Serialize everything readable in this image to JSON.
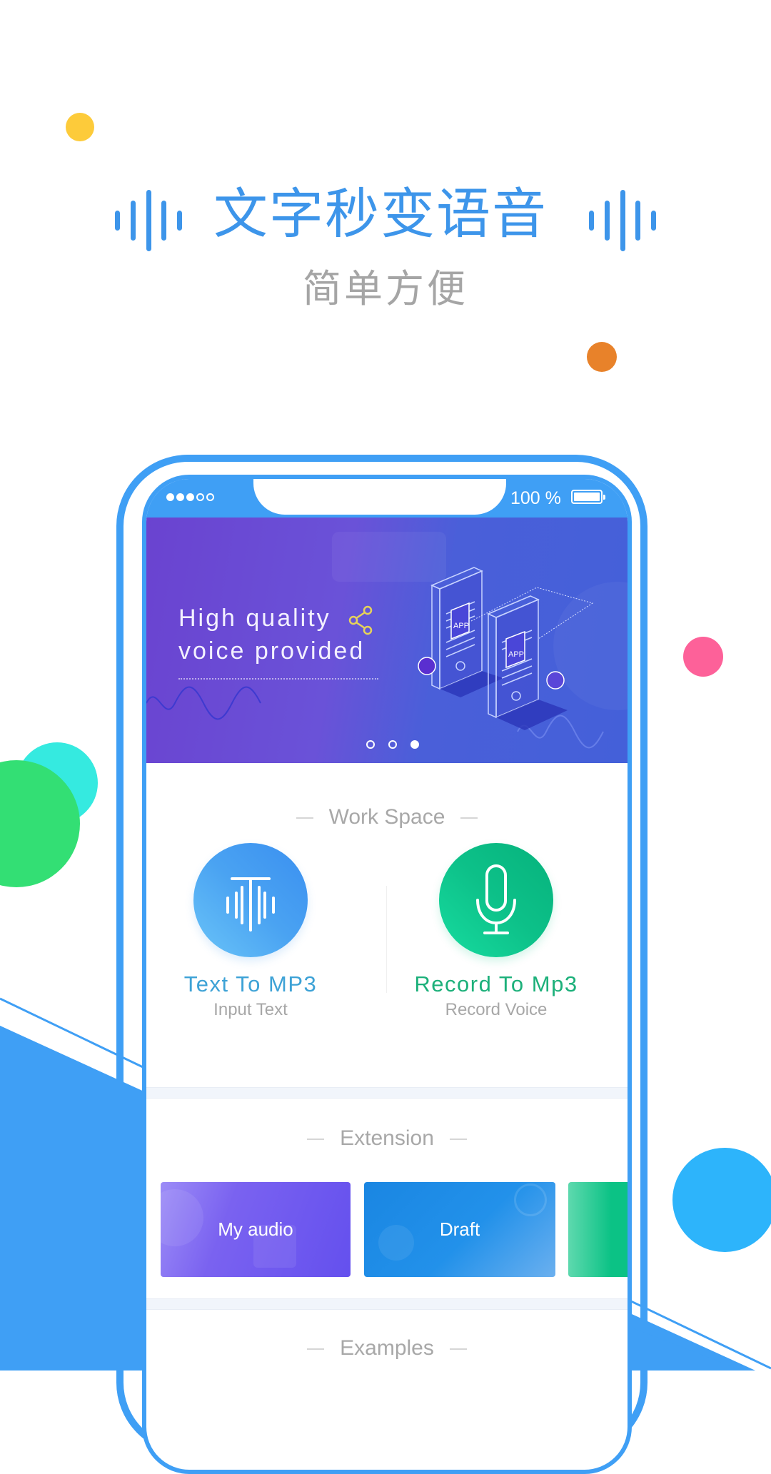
{
  "hero": {
    "title": "文字秒变语音",
    "subtitle": "简单方便"
  },
  "colors": {
    "accent_blue": "#3d95ea",
    "frame_blue": "#3f9ff5",
    "record_green": "#1ec08a",
    "dot_yellow": "#fdcb3a",
    "dot_orange": "#e8822a",
    "dot_pink": "#fd6199",
    "dot_cyan": "#35eae0",
    "dot_green": "#33df74",
    "dot_sky": "#2db4fb"
  },
  "phone": {
    "status_bar": {
      "signal_filled": 3,
      "signal_total": 5,
      "battery_text": "100 %",
      "battery_level_percent": 100
    },
    "banner": {
      "line1": "High quality",
      "line2": "voice provided",
      "illustration_label_1": "APP",
      "illustration_label_2": "APP",
      "page_count": 3,
      "active_page": 3
    },
    "work_space": {
      "title": "Work Space",
      "items": [
        {
          "title": "Text To MP3",
          "subtitle": "Input Text",
          "icon": "text-wave-icon"
        },
        {
          "title": "Record To Mp3",
          "subtitle": "Record Voice",
          "icon": "microphone-icon"
        }
      ]
    },
    "extension": {
      "title": "Extension",
      "cards": [
        {
          "label": "My audio"
        },
        {
          "label": "Draft"
        },
        {
          "label": ""
        }
      ]
    },
    "examples": {
      "title": "Examples"
    }
  }
}
